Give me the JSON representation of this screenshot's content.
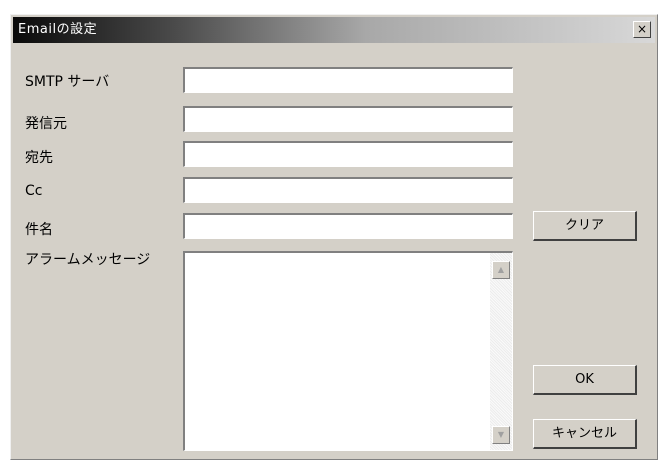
{
  "dialog": {
    "title": "Emailの設定",
    "close_label": "×"
  },
  "form": {
    "smtp_label": "SMTP サーバ",
    "from_label": "発信元",
    "to_label": "宛先",
    "cc_label": "Cc",
    "subject_label": "件名",
    "message_label": "アラームメッセージ",
    "smtp_value": "",
    "from_value": "",
    "to_value": "",
    "cc_value": "",
    "subject_value": "",
    "message_value": ""
  },
  "scrollbar": {
    "up_glyph": "▲",
    "down_glyph": "▼"
  },
  "buttons": {
    "clear_label": "クリア",
    "ok_label": "OK",
    "cancel_label": "キャンセル"
  }
}
